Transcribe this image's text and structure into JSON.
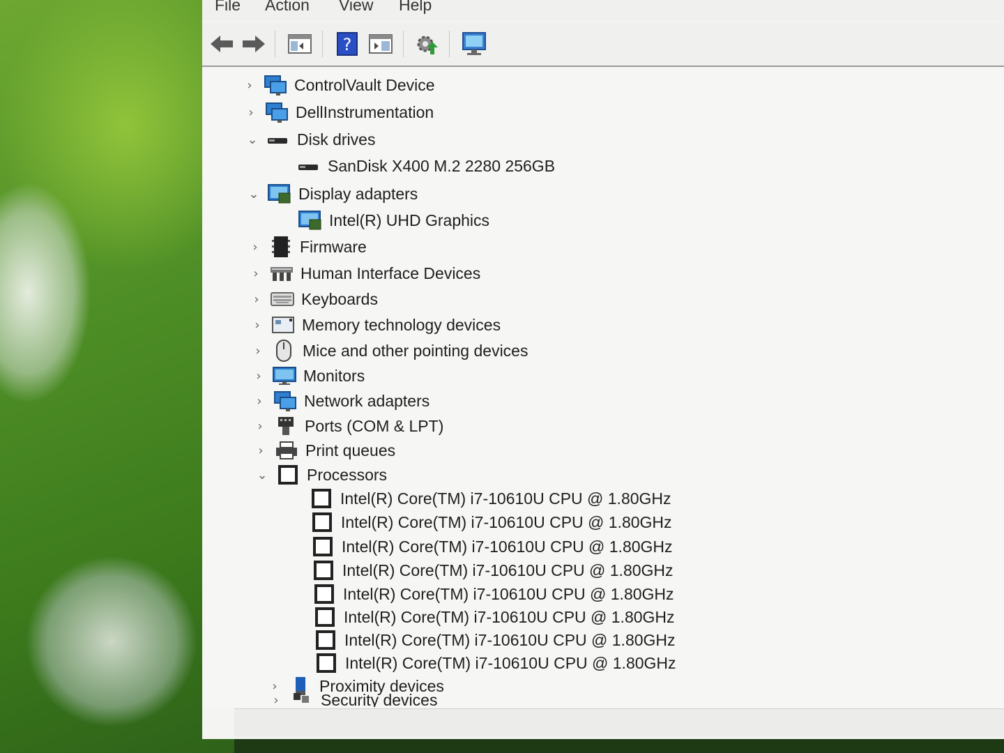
{
  "menu": {
    "file": "File",
    "action": "Action",
    "view": "View",
    "help": "Help"
  },
  "toolbar": {
    "back": "back-icon",
    "forward": "forward-icon",
    "show_hide": "console-tree-icon",
    "help": "help-icon",
    "properties": "properties-icon",
    "update": "update-driver-icon",
    "scan": "scan-hardware-icon"
  },
  "tree": {
    "controlvault": "ControlVault Device",
    "dellinstrumentation": "DellInstrumentation",
    "disk_drives": "Disk drives",
    "disk_drive_item": "SanDisk X400 M.2 2280 256GB",
    "display_adapters": "Display adapters",
    "display_item": "Intel(R) UHD Graphics",
    "firmware": "Firmware",
    "hid": "Human Interface Devices",
    "keyboards": "Keyboards",
    "memory_tech": "Memory technology devices",
    "mice": "Mice and other pointing devices",
    "monitors": "Monitors",
    "network_adapters": "Network adapters",
    "ports": "Ports (COM & LPT)",
    "print_queues": "Print queues",
    "processors": "Processors",
    "processor_items": [
      "Intel(R) Core(TM) i7-10610U CPU @ 1.80GHz",
      "Intel(R) Core(TM) i7-10610U CPU @ 1.80GHz",
      "Intel(R) Core(TM) i7-10610U CPU @ 1.80GHz",
      "Intel(R) Core(TM) i7-10610U CPU @ 1.80GHz",
      "Intel(R) Core(TM) i7-10610U CPU @ 1.80GHz",
      "Intel(R) Core(TM) i7-10610U CPU @ 1.80GHz",
      "Intel(R) Core(TM) i7-10610U CPU @ 1.80GHz",
      "Intel(R) Core(TM) i7-10610U CPU @ 1.80GHz"
    ],
    "proximity": "Proximity devices",
    "security": "Security devices"
  },
  "chevrons": {
    "collapsed": "›",
    "expanded": "⌄"
  }
}
